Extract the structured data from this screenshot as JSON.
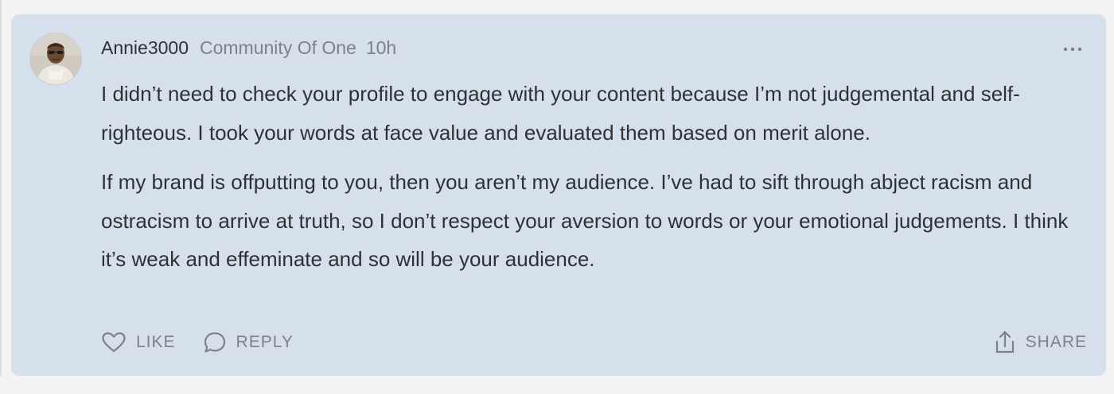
{
  "comment": {
    "author": "Annie3000",
    "community": "Community Of One",
    "time": "10h",
    "paragraphs": [
      "I didn’t need to check your profile to engage with your content because I’m not judgemental and self-righteous. I took your words at face value and evaluated them based on merit alone.",
      "If my brand is offputting to you, then you aren’t my audience. I’ve had to sift through abject racism and ostracism to arrive at truth, so I don’t respect your aversion to words or your emotional judgements. I think it’s weak and effeminate and so will be your audience."
    ],
    "actions": {
      "like": "LIKE",
      "reply": "REPLY",
      "share": "SHARE"
    },
    "icons": {
      "avatar": "avatar-photo",
      "more": "more-dots-icon",
      "like": "heart-icon",
      "reply": "speech-bubble-icon",
      "share": "share-upload-icon"
    }
  },
  "colors": {
    "card_background": "#d6e0ec",
    "page_background": "#f3f3f3",
    "text": "#2f3136",
    "muted": "#7d8188"
  }
}
